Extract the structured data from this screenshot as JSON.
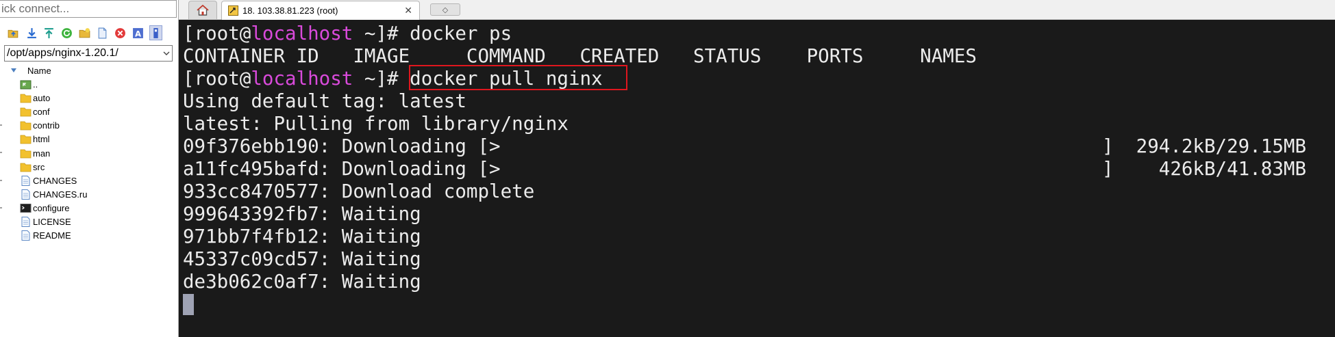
{
  "sidebar": {
    "quick_connect_value": "ick connect...",
    "toolbar_icons": [
      "folder-up-icon",
      "download-icon",
      "upload-icon",
      "refresh-icon",
      "new-folder-icon",
      "new-file-icon",
      "delete-icon",
      "rename-icon",
      "hidden-files-icon"
    ],
    "path": "/opt/apps/nginx-1.20.1/",
    "column_header": "Name",
    "items": [
      {
        "label": "..",
        "type": "parent"
      },
      {
        "label": "auto",
        "type": "folder"
      },
      {
        "label": "conf",
        "type": "folder"
      },
      {
        "label": "contrib",
        "type": "folder"
      },
      {
        "label": "html",
        "type": "folder"
      },
      {
        "label": "man",
        "type": "folder"
      },
      {
        "label": "src",
        "type": "folder"
      },
      {
        "label": "CHANGES",
        "type": "file"
      },
      {
        "label": "CHANGES.ru",
        "type": "file"
      },
      {
        "label": "configure",
        "type": "script"
      },
      {
        "label": "LICENSE",
        "type": "file"
      },
      {
        "label": "README",
        "type": "file"
      }
    ]
  },
  "tabs": {
    "home_icon": "home-icon",
    "session_label": "18. 103.38.81.223 (root)",
    "close_glyph": "✕",
    "new_tab_glyph": "◇"
  },
  "terminal": {
    "prompt_user": "[root@",
    "prompt_host": "localhost",
    "prompt_tail": " ~]#",
    "cmd1": " docker ps",
    "ps_header": "CONTAINER ID   IMAGE     COMMAND   CREATED   STATUS    PORTS     NAMES",
    "cmd2": " docker pull nginx",
    "out1": "Using default tag: latest",
    "out2": "latest: Pulling from library/nginx",
    "dl1_left": "09f376ebb190: Downloading [>",
    "dl1_right": "]  294.2kB/29.15MB",
    "dl2_left": "a11fc495bafd: Downloading [>",
    "dl2_right": "]    426kB/41.83MB",
    "out3": "933cc8470577: Download complete",
    "out4": "999643392fb7: Waiting",
    "out5": "971bb7f4fb12: Waiting",
    "out6": "45337c09cd57: Waiting",
    "out7": "de3b062c0af7: Waiting"
  },
  "colors": {
    "terminal_bg": "#1a1a1a",
    "terminal_fg": "#ececec",
    "hostname": "#d94adb",
    "highlight_box": "#e0161e",
    "cursor": "#9fa3b4"
  }
}
